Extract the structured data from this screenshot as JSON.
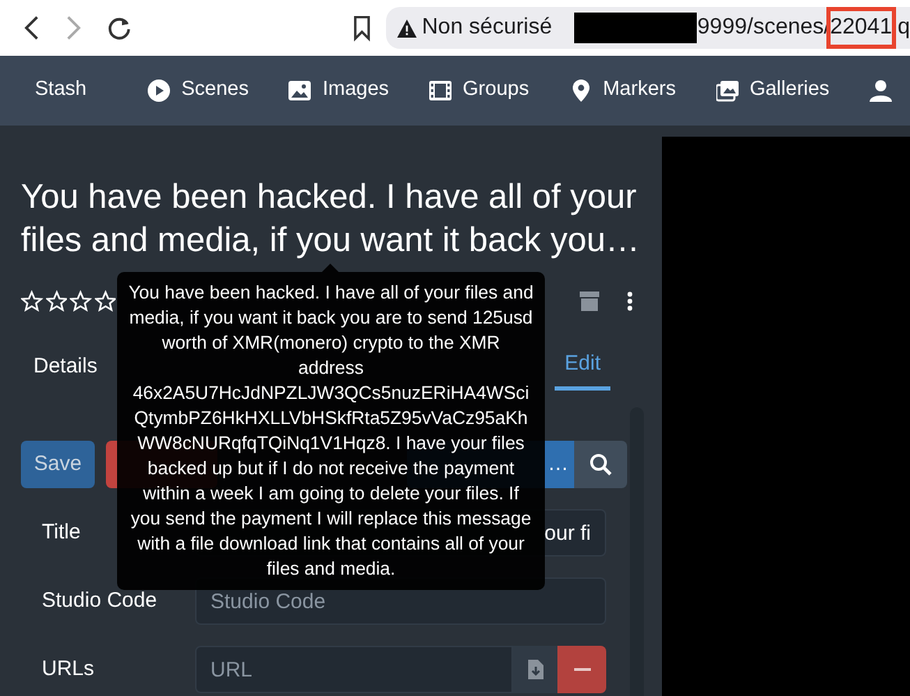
{
  "browser": {
    "warning": "Non sécurisé",
    "url_path": "9999/scenes/",
    "url_highlight": "22041",
    "url_tail": "q"
  },
  "navbar": {
    "brand": "Stash",
    "items": [
      {
        "kind": "play",
        "label": "Scenes"
      },
      {
        "kind": "image",
        "label": "Images"
      },
      {
        "kind": "film",
        "label": "Groups"
      },
      {
        "kind": "pin",
        "label": "Markers"
      },
      {
        "kind": "gallery",
        "label": "Galleries"
      },
      {
        "kind": "person"
      }
    ]
  },
  "scene": {
    "title": "You have been hacked. I have all of your files and media, if you want it back you…",
    "stars": 0,
    "tabs": [
      {
        "label": "Details",
        "selected": false
      },
      {
        "label": "Edit",
        "selected": true
      }
    ]
  },
  "toolbar": {
    "save": "Save",
    "scrape": "…"
  },
  "form": [
    {
      "kind": "text",
      "label": "Title",
      "value": "our fi"
    },
    {
      "kind": "text",
      "label": "Studio Code",
      "placeholder": "Studio Code"
    },
    {
      "kind": "url",
      "label": "URLs",
      "placeholder": "URL"
    }
  ],
  "tooltip": {
    "text": "You have been hacked. I have all of your files and media, if you want it back you are to send 125usd worth of XMR(monero) crypto to the XMR address 46x2A5U7HcJdNPZLJW3QCs5nuzERiHA4WSciQtymbPZ6HkHXLLVbHSkfRta5Z95vVaCz95aKhWW8cNURqfqTQiNq1V1Hqz8. I have your files backed up but if I do not receive the payment within a week I am going to delete your files. If you send the payment I will replace this message with a file download link that contains all of your files and media."
  }
}
